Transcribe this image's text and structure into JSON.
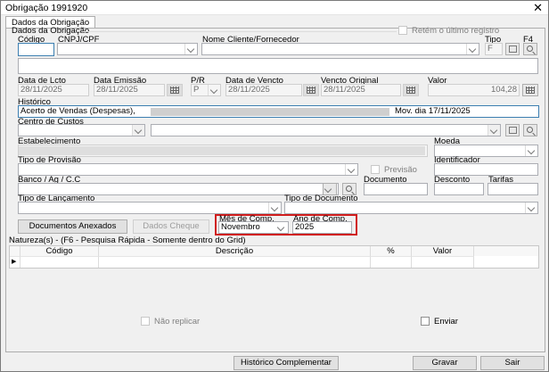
{
  "window": {
    "title": "Obrigação 1991920"
  },
  "tab": {
    "label": "Dados da Obrigação"
  },
  "section": {
    "title": "Dados da Obrigação"
  },
  "retem": {
    "label": "Retém o último registro"
  },
  "labels": {
    "codigo": "Código",
    "cnpj": "CNPJ/CPF",
    "nome": "Nome Cliente/Fornecedor",
    "tipo": "Tipo",
    "f4": "F4",
    "data_lcto": "Data de Lcto",
    "data_emissao": "Data Emissão",
    "pr": "P/R",
    "data_vencto": "Data de Vencto",
    "vencto_original": "Vencto Original",
    "valor": "Valor",
    "historico": "Histórico",
    "centro_custos": "Centro de Custos",
    "estabelecimento": "Estabelecimento",
    "moeda": "Moeda",
    "tipo_provisao": "Tipo de Provisão",
    "previsao": "Previsão",
    "identificador": "Identificador",
    "banco": "Banco / Ag / C.C",
    "documento": "Documento",
    "desconto": "Desconto",
    "tarifas": "Tarifas",
    "tipo_lancamento": "Tipo de Lançamento",
    "tipo_documento": "Tipo de Documento",
    "mes_comp": "Mês de Comp.",
    "ano_comp": "Ano de Comp."
  },
  "values": {
    "tipo": "F",
    "data_lcto": "28/11/2025",
    "data_emissao": "28/11/2025",
    "pr": "P",
    "data_vencto": "28/11/2025",
    "vencto_original": "28/11/2025",
    "valor": "104,28",
    "historico_start": "Acerto de Vendas (Despesas),",
    "historico_end": "Mov. dia 17/11/2025",
    "mes_comp": "Novembro",
    "ano_comp": "2025"
  },
  "buttons": {
    "documentos_anexados": "Documentos Anexados",
    "dados_cheque": "Dados Cheque",
    "historico_complementar": "Histórico Complementar",
    "gravar": "Gravar",
    "sair": "Sair"
  },
  "natureza": {
    "title": "Natureza(s) - (F6 - Pesquisa Rápida - Somente dentro do Grid)",
    "columns": [
      "Código",
      "Descrição",
      "%",
      "Valor"
    ]
  },
  "footer": {
    "nao_replicar": "Não replicar",
    "enviar": "Enviar"
  }
}
